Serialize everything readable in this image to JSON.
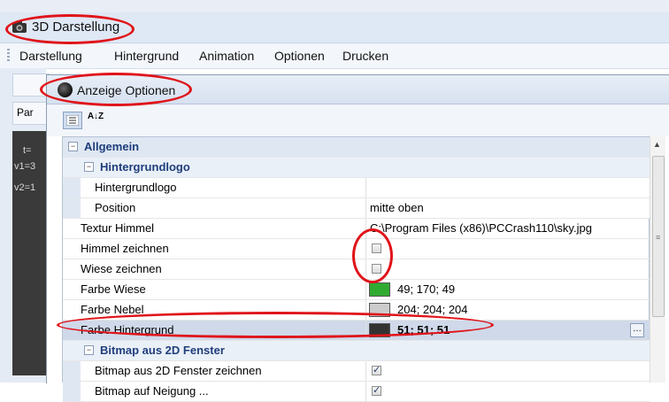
{
  "outer_window": {
    "title": "3D Darstellung"
  },
  "menu": {
    "items": [
      "Darstellung",
      "Hintergrund",
      "Animation",
      "Optionen",
      "Drucken"
    ]
  },
  "left_panel": {
    "tab_label": "Par",
    "dark_labels": [
      "t=",
      "v1=3",
      "v2=1"
    ]
  },
  "dialog": {
    "title": "Anzeige Optionen",
    "sort_az_label": "A↓Z"
  },
  "grid": {
    "cat_allgemein": "Allgemein",
    "cat_hintergrundlogo": "Hintergrundlogo",
    "row_hintergrundlogo": {
      "name": "Hintergrundlogo",
      "value": ""
    },
    "row_position": {
      "name": "Position",
      "value": "mitte oben"
    },
    "row_textur": {
      "name": "Textur Himmel",
      "value": "C:\\Program Files (x86)\\PCCrash110\\sky.jpg"
    },
    "row_himmel": {
      "name": "Himmel zeichnen",
      "checked": false
    },
    "row_wiese": {
      "name": "Wiese zeichnen",
      "checked": false
    },
    "row_farbe_wiese": {
      "name": "Farbe Wiese",
      "value": "49; 170; 49",
      "color": "#31aa31"
    },
    "row_farbe_nebel": {
      "name": "Farbe Nebel",
      "value": "204; 204; 204",
      "color": "#cccccc"
    },
    "row_farbe_hintergrund": {
      "name": "Farbe Hintergrund",
      "value": "51; 51; 51",
      "color": "#333333"
    },
    "cat_bitmap": "Bitmap aus 2D Fenster",
    "row_bitmap": {
      "name": "Bitmap aus 2D Fenster zeichnen",
      "checked": true
    },
    "row_bitmap2": {
      "name": "Bitmap auf Neigung ...",
      "checked": true
    }
  },
  "colors": {
    "annotation": "#e0141a",
    "category_bg": "#dfe7f3",
    "category_text": "#1f3e7b"
  }
}
